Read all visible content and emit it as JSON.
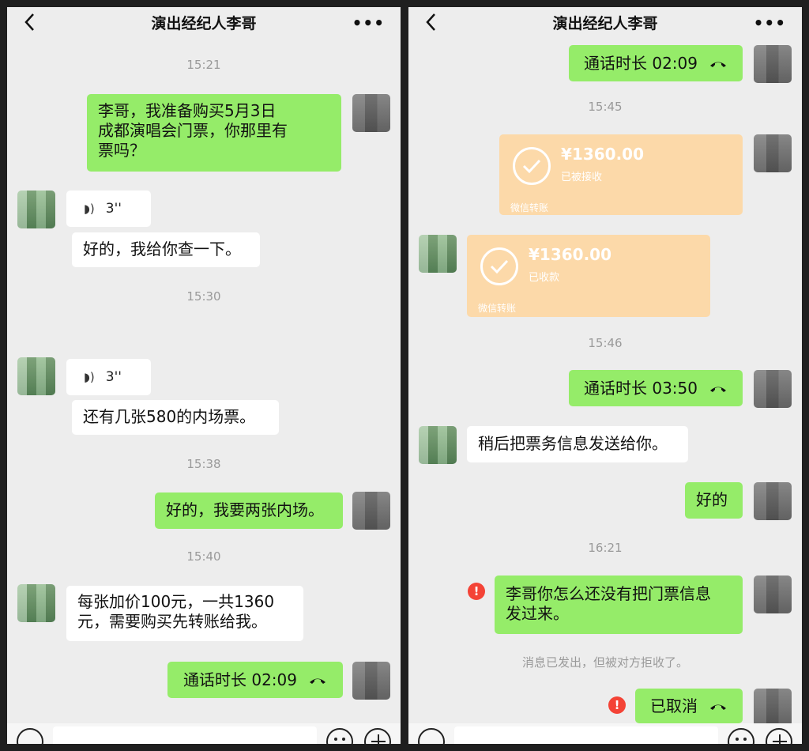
{
  "left": {
    "header": {
      "title": "演出经纪人李哥"
    },
    "times": [
      "15:21",
      "15:30",
      "15:38",
      "15:40"
    ],
    "messages": {
      "m1": [
        "李哥，我准备购买5月3日",
        "成都演唱会门票，你那里有",
        "票吗？"
      ],
      "voice1": "3''",
      "m2": "好的，我给你查一下。",
      "voice2": "3''",
      "m3": "还有几张580的内场票。",
      "m4": "好的，我要两张内场。",
      "m5": [
        "每张加价100元，一共1360",
        "元，需要购买先转账给我。"
      ],
      "call1": "通话时长 02:09"
    }
  },
  "right": {
    "header": {
      "title": "演出经纪人李哥"
    },
    "times": [
      "15:45",
      "15:46",
      "16:21"
    ],
    "messages": {
      "call1": "通话时长 02:09",
      "transfer1": {
        "amount": "¥1360.00",
        "status": "已被接收",
        "footer": "微信转账"
      },
      "transfer2": {
        "amount": "¥1360.00",
        "status": "已收款",
        "footer": "微信转账"
      },
      "call2": "通话时长 03:50",
      "m1": "稍后把票务信息发送给你。",
      "m2": "好的",
      "m3": [
        "李哥你怎么还没有把门票信息",
        "发过来。"
      ],
      "system": "消息已发出，但被对方拒收了。",
      "m4": "已取消"
    }
  },
  "icons": {
    "error": "!",
    "voice_wave": "🔊"
  },
  "colors": {
    "out_bubble": "#95ec69",
    "in_bubble": "#ffffff",
    "transfer": "#fcd9a9",
    "error": "#f44336",
    "bg": "#ededed"
  }
}
